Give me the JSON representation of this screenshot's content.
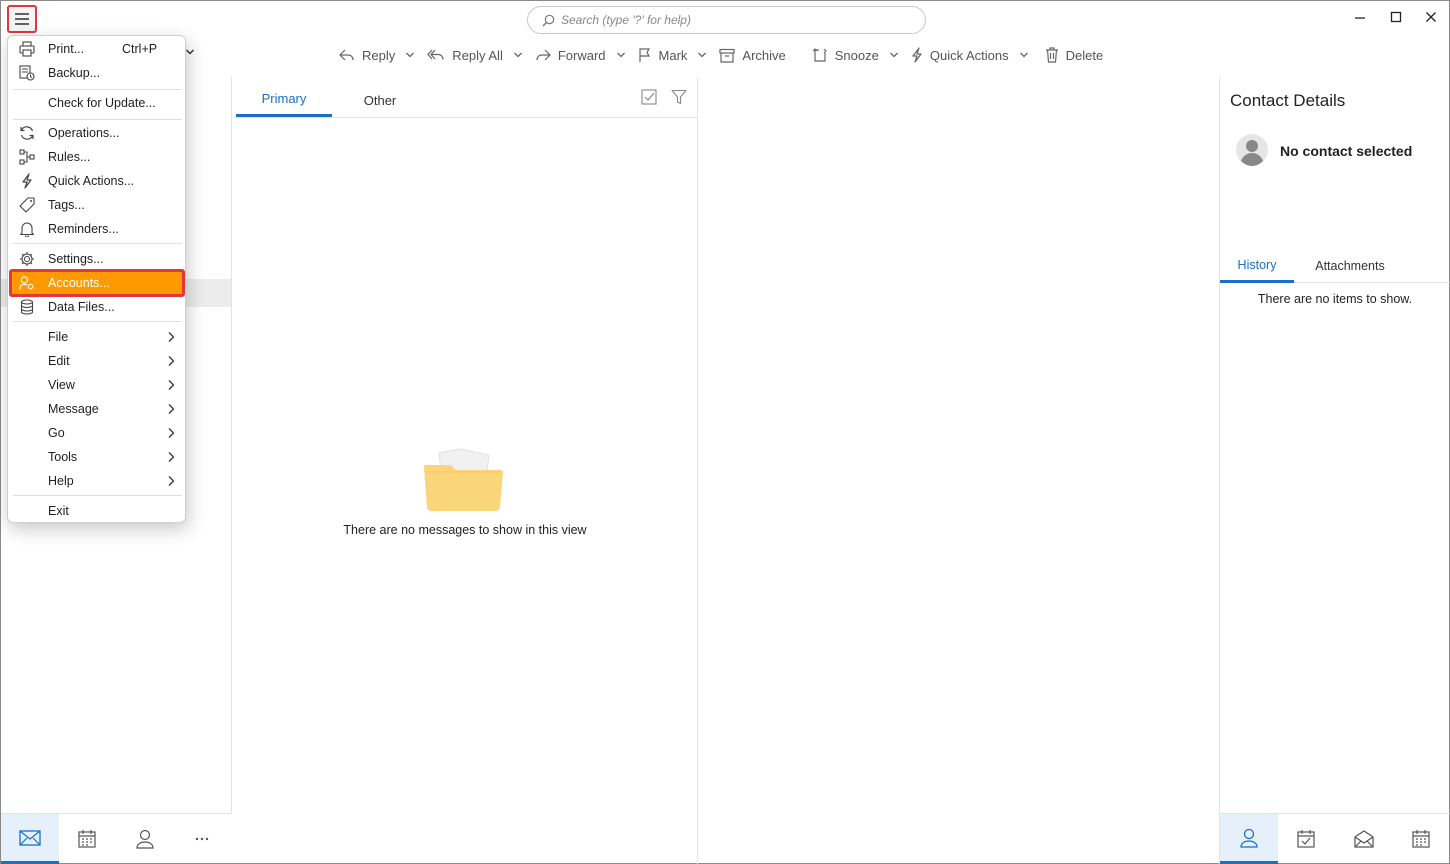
{
  "titlebar": {
    "search_placeholder": "Search (type '?' for help)"
  },
  "toolbar": {
    "reply": "Reply",
    "reply_all": "Reply All",
    "forward": "Forward",
    "mark": "Mark",
    "archive": "Archive",
    "snooze": "Snooze",
    "quick_actions": "Quick Actions",
    "delete": "Delete"
  },
  "menu": {
    "print": "Print...",
    "print_shortcut": "Ctrl+P",
    "backup": "Backup...",
    "check_update": "Check for Update...",
    "operations": "Operations...",
    "rules": "Rules...",
    "quick_actions": "Quick Actions...",
    "tags": "Tags...",
    "reminders": "Reminders...",
    "settings": "Settings...",
    "accounts": "Accounts...",
    "data_files": "Data Files...",
    "file": "File",
    "edit": "Edit",
    "view": "View",
    "message": "Message",
    "go": "Go",
    "tools": "Tools",
    "help": "Help",
    "exit": "Exit"
  },
  "message_list": {
    "tabs": [
      "Primary",
      "Other"
    ],
    "empty_text": "There are no messages to show in this view"
  },
  "contact": {
    "title": "Contact Details",
    "name": "No contact selected",
    "tabs": [
      "History",
      "Attachments"
    ],
    "empty_text": "There are no items to show."
  },
  "colors": {
    "accent": "#1a6fc9",
    "menu_highlight": "#ff9900",
    "highlight_border": "#e0383e"
  }
}
